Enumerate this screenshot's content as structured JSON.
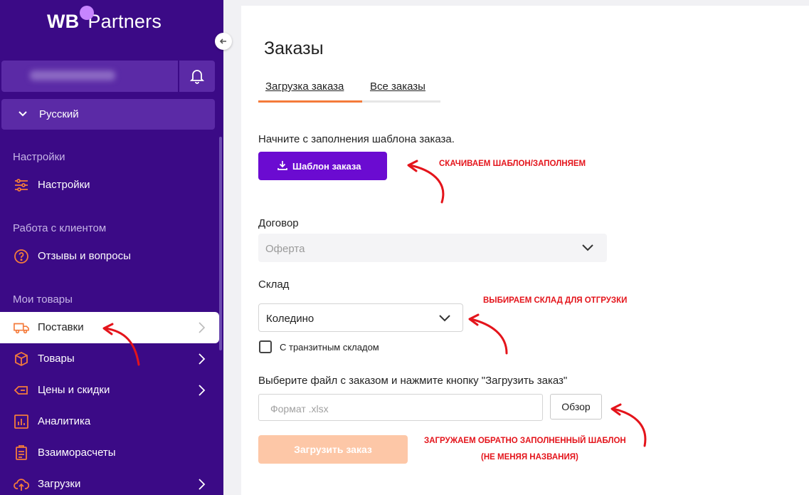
{
  "app": {
    "logo_wb": "WB",
    "logo_partners": "Partners"
  },
  "sidebar": {
    "language": "Русский",
    "sections": [
      {
        "title": "Настройки"
      },
      {
        "title": "Работа с клиентом"
      },
      {
        "title": "Мои товары"
      }
    ],
    "items": [
      {
        "label": "Настройки",
        "icon": "sliders-icon"
      },
      {
        "label": "Отзывы и вопросы",
        "icon": "question-icon"
      },
      {
        "label": "Поставки",
        "icon": "truck-icon",
        "active": true
      },
      {
        "label": "Товары",
        "icon": "box-icon"
      },
      {
        "label": "Цены и скидки",
        "icon": "tag-icon"
      },
      {
        "label": "Аналитика",
        "icon": "chart-icon"
      },
      {
        "label": "Взаиморасчеты",
        "icon": "clipboard-icon"
      },
      {
        "label": "Загрузки",
        "icon": "cloud-upload-icon"
      }
    ]
  },
  "main": {
    "title": "Заказы",
    "tabs": [
      {
        "label": "Загрузка заказа",
        "active": true
      },
      {
        "label": "Все заказы"
      }
    ],
    "template_hint": "Начните с заполнения шаблона заказа.",
    "template_button": "Шаблон заказа",
    "contract_label": "Договор",
    "contract_value": "Оферта",
    "stock_label": "Склад",
    "stock_value": "Коледино",
    "transit_checkbox": "С транзитным складом",
    "transit_checked": false,
    "file_hint": "Выберите файл с заказом и нажмите кнопку \"Загрузить заказ\"",
    "file_placeholder": "Формат .xlsx",
    "browse_button": "Обзор",
    "upload_button": "Загрузить заказ"
  },
  "annotations": {
    "download_template": "СКАЧИВАЕМ ШАБЛОН/ЗАПОЛНЯЕМ",
    "choose_stock": "ВЫБИРАЕМ СКЛАД ДЛЯ ОТГРУЗКИ",
    "upload_back_1": "ЗАГРУЖАЕМ ОБРАТНО ЗАПОЛНЕННЫЙ ШАБЛОН",
    "upload_back_2": "(НЕ МЕНЯЯ НАЗВАНИЯ)"
  },
  "colors": {
    "sidebar_bg": "#3b0a86",
    "accent_orange": "#f47b3b",
    "primary_button": "#6b0bd1",
    "annotation_red": "#e4141b"
  }
}
